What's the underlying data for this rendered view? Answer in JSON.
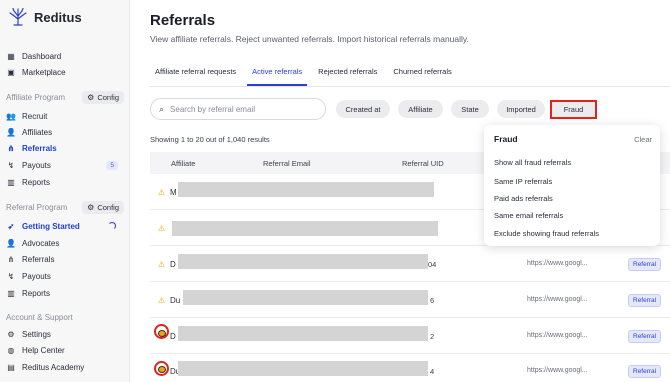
{
  "app": {
    "brand": "Reditus"
  },
  "sidebar": {
    "top_items": [
      {
        "label": "Dashboard",
        "icon": "dashboard-icon"
      },
      {
        "label": "Marketplace",
        "icon": "marketplace-icon"
      }
    ],
    "affiliate_section": {
      "title": "Affiliate Program",
      "config_label": "Config"
    },
    "affiliate_items": [
      {
        "label": "Recruit"
      },
      {
        "label": "Affiliates"
      },
      {
        "label": "Referrals",
        "active": true
      },
      {
        "label": "Payouts",
        "badge": "5"
      },
      {
        "label": "Reports"
      }
    ],
    "referral_section": {
      "title": "Referral Program",
      "config_label": "Config"
    },
    "referral_items": [
      {
        "label": "Getting Started"
      },
      {
        "label": "Advocates"
      },
      {
        "label": "Referrals"
      },
      {
        "label": "Payouts"
      },
      {
        "label": "Reports"
      }
    ],
    "account_section": {
      "title": "Account & Support"
    },
    "account_items": [
      {
        "label": "Settings"
      },
      {
        "label": "Help Center"
      },
      {
        "label": "Reditus Academy"
      }
    ]
  },
  "main": {
    "title": "Referrals",
    "subtitle": "View affiliate referrals. Reject unwanted referrals. Import historical referrals manually.",
    "tabs": [
      {
        "label": "Affiliate referral requests"
      },
      {
        "label": "Active referrals",
        "active": true
      },
      {
        "label": "Rejected referrals"
      },
      {
        "label": "Churned referrals"
      }
    ],
    "search": {
      "placeholder": "Search by referral email"
    },
    "filters": [
      "Created at",
      "Affiliate",
      "State",
      "Imported",
      "Fraud"
    ],
    "results_text": "Showing 1 to 20 out of 1,040 results",
    "table": {
      "columns": [
        "Affiliate",
        "Referral Email",
        "Referral UID"
      ],
      "rows": [
        {
          "letter": "M",
          "tail": "",
          "url": "",
          "badge": ""
        },
        {
          "letter": "",
          "tail": "",
          "url": "",
          "badge": ""
        },
        {
          "letter": "D",
          "tail": "04",
          "url": "https://www.googl...",
          "badge": "Referral"
        },
        {
          "letter": "Du",
          "tail": "6",
          "url": "https://www.googl...",
          "badge": "Referral"
        },
        {
          "letter": "D",
          "tail": "2",
          "url": "https://www.googl...",
          "badge": "Referral"
        },
        {
          "letter": "Du",
          "tail": "4",
          "url": "https://www.googl...",
          "badge": "Referral"
        }
      ]
    }
  },
  "fraud_dropdown": {
    "title": "Fraud",
    "clear_label": "Clear",
    "options": [
      "Show all fraud referrals",
      "Same IP referrals",
      "Paid ads referrals",
      "Same email referrals",
      "Exclude showing fraud referrals"
    ]
  },
  "colors": {
    "accent": "#2a3fd6",
    "highlight": "#e0241d",
    "warning": "#f5a300"
  }
}
